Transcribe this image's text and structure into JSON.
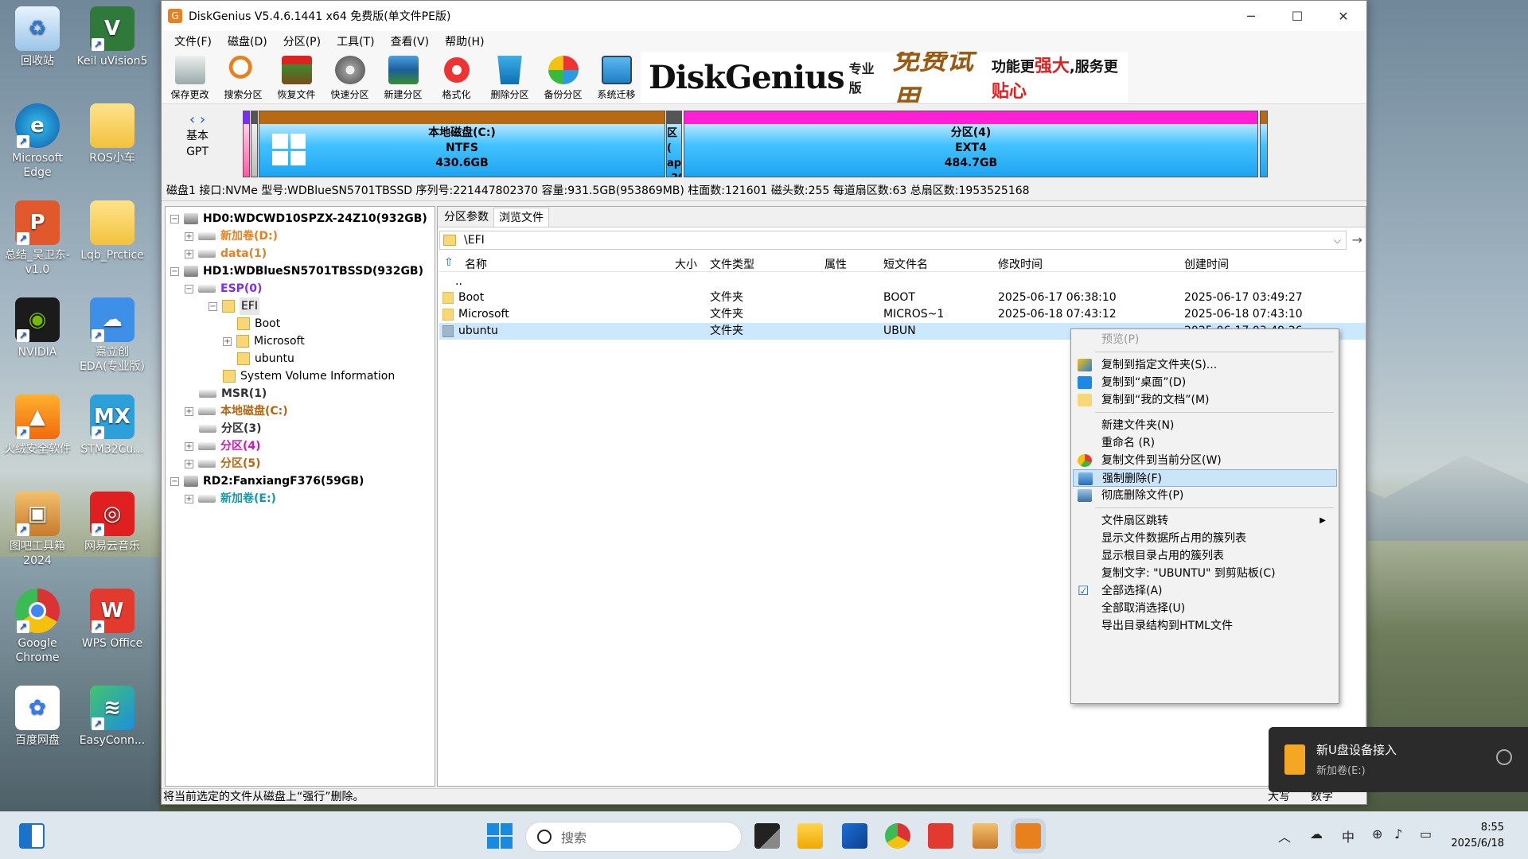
{
  "desktop": {
    "icons": [
      {
        "label": "回收站"
      },
      {
        "label": "Keil uVision5"
      },
      {
        "label": "Microsoft Edge"
      },
      {
        "label": "ROS小车"
      },
      {
        "label": "总结_吴卫东-v1.0"
      },
      {
        "label": "Lqb_Prctice"
      },
      {
        "label": "NVIDIA"
      },
      {
        "label": "嘉立创EDA(专业版)"
      },
      {
        "label": "火绒安全软件"
      },
      {
        "label": "STM32Cu..."
      },
      {
        "label": "图吧工具箱2024"
      },
      {
        "label": "网易云音乐"
      },
      {
        "label": "Google Chrome"
      },
      {
        "label": "WPS Office"
      },
      {
        "label": "百度网盘"
      },
      {
        "label": "EasyConn..."
      }
    ]
  },
  "window": {
    "title": "DiskGenius V5.4.6.1441 x64 免费版(单文件PE版)",
    "menu": [
      "文件(F)",
      "磁盘(D)",
      "分区(P)",
      "工具(T)",
      "查看(V)",
      "帮助(H)"
    ],
    "toolbar": [
      "保存更改",
      "搜索分区",
      "恢复文件",
      "快速分区",
      "新建分区",
      "格式化",
      "删除分区",
      "备份分区",
      "系统迁移"
    ],
    "banner": {
      "brand": "DiskGenius",
      "edition": "专业版",
      "slogan": "免费试用",
      "tag_a": "功能更",
      "tag_b": "强大",
      "tag_c": ",服务更",
      "tag_d": "贴心"
    }
  },
  "diskmap": {
    "label_top": "基本",
    "label_bottom": "GPT",
    "partitions": [
      {
        "name": "本地磁盘(C:)",
        "fs": "NTFS",
        "size": "430.6GB"
      },
      {
        "name": "区(",
        "fs": "ap",
        "size": ".30"
      },
      {
        "name": "分区(4)",
        "fs": "EXT4",
        "size": "484.7GB"
      }
    ]
  },
  "disk_info": "磁盘1 接口:NVMe 型号:WDBlueSN5701TBSSD 序列号:221447802370 容量:931.5GB(953869MB) 柱面数:121601 磁头数:255 每道扇区数:63 总扇区数:1953525168",
  "tree": {
    "hd0": "HD0:WDCWD10SPZX-24Z10(932GB)",
    "new_d": "新加卷(D:)",
    "data1": "data(1)",
    "hd1": "HD1:WDBlueSN5701TBSSD(932GB)",
    "esp": "ESP(0)",
    "efi": "EFI",
    "boot": "Boot",
    "microsoft": "Microsoft",
    "ubuntu": "ubuntu",
    "svi": "System Volume Information",
    "msr": "MSR(1)",
    "c": "本地磁盘(C:)",
    "p3": "分区(3)",
    "p4": "分区(4)",
    "p5": "分区(5)",
    "rd2": "RD2:FanxiangF376(59GB)",
    "new_e": "新加卷(E:)"
  },
  "browser": {
    "tabs": [
      "分区参数",
      "浏览文件"
    ],
    "path": "\\EFI",
    "columns": [
      "名称",
      "大小",
      "文件类型",
      "属性",
      "短文件名",
      "修改时间",
      "创建时间"
    ],
    "parent": "..",
    "rows": [
      {
        "name": "Boot",
        "type": "文件夹",
        "short": "BOOT",
        "modified": "2025-06-17 06:38:10",
        "created": "2025-06-17 03:49:27"
      },
      {
        "name": "Microsoft",
        "type": "文件夹",
        "short": "MICROS~1",
        "modified": "2025-06-18 07:43:12",
        "created": "2025-06-18 07:43:10"
      },
      {
        "name": "ubuntu",
        "type": "文件夹",
        "short": "UBUN",
        "modified": "",
        "created": "2025-06-17 03:49:26"
      }
    ]
  },
  "context_menu": {
    "preview": "预览(P)",
    "copy_to_folder": "复制到指定文件夹(S)...",
    "copy_to_desktop": "复制到“桌面”(D)",
    "copy_to_docs": "复制到“我的文档”(M)",
    "new_folder": "新建文件夹(N)",
    "rename": "重命名 (R)",
    "copy_to_partition": "复制文件到当前分区(W)",
    "force_delete": "强制删除(F)",
    "wipe_delete": "彻底删除文件(P)",
    "sector_jump": "文件扇区跳转",
    "show_clusters": "显示文件数据所占用的簇列表",
    "show_root_clusters": "显示根目录占用的簇列表",
    "copy_text": "复制文字: \"UBUNTU\" 到剪贴板(C)",
    "select_all": "全部选择(A)",
    "deselect_all": "全部取消选择(U)",
    "export_html": "导出目录结构到HTML文件"
  },
  "status": {
    "message": "将当前选定的文件从磁盘上“强行”删除。",
    "caps": "大写",
    "num": "数字"
  },
  "toast": {
    "title": "新U盘设备接入",
    "subtitle": "新加卷(E:)"
  },
  "taskbar": {
    "search_placeholder": "搜索",
    "ime": "中",
    "time": "8:55",
    "date": "2025/6/18"
  }
}
